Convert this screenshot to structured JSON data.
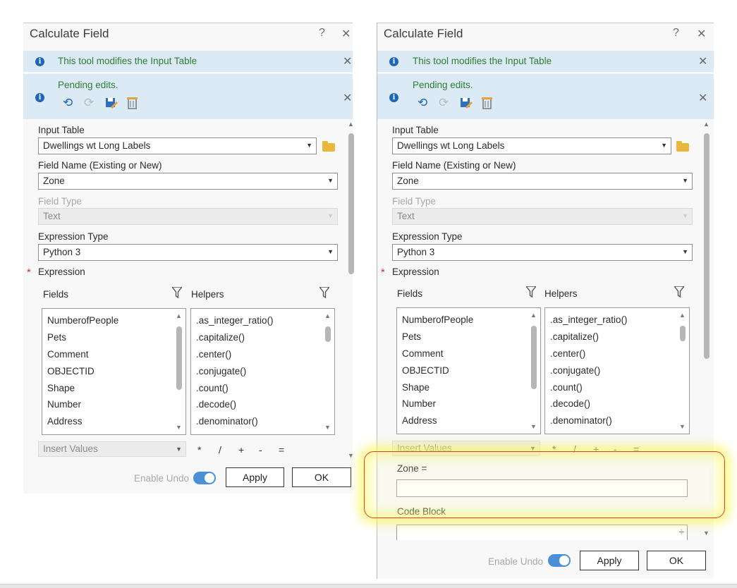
{
  "dialog": {
    "title": "Calculate Field",
    "help": "?",
    "close": "✕",
    "notice": "This tool modifies the Input Table",
    "pending": "Pending edits.",
    "input_table_label": "Input Table",
    "input_table_value": "Dwellings wt Long Labels",
    "field_name_label": "Field Name (Existing or New)",
    "field_name_value": "Zone",
    "field_type_label": "Field Type",
    "field_type_value": "Text",
    "expression_type_label": "Expression Type",
    "expression_type_value": "Python 3",
    "expression_label": "Expression",
    "required_mark": "*",
    "fields_label": "Fields",
    "helpers_label": "Helpers",
    "fields": [
      "NumberofPeople",
      "Pets",
      "Comment",
      "OBJECTID",
      "Shape",
      "Number",
      "Address"
    ],
    "helpers": [
      ".as_integer_ratio()",
      ".capitalize()",
      ".center()",
      ".conjugate()",
      ".count()",
      ".decode()",
      ".denominator()"
    ],
    "insert_values": "Insert Values",
    "ops": [
      "*",
      "/",
      "+",
      "-",
      "="
    ],
    "zone_expr_label": "Zone =",
    "code_block_label": "Code Block",
    "enable_undo": "Enable Undo",
    "apply": "Apply",
    "ok": "OK"
  },
  "icons": {
    "info": "info-icon",
    "undo": "undo-icon",
    "redo": "redo-icon",
    "save_edits": "save-edits-icon",
    "discard_edits": "discard-edits-icon",
    "folder": "folder-icon",
    "filter": "filter-icon"
  },
  "colors": {
    "banner": "#dbeaf4",
    "notice_text": "#2e7d32",
    "info_icon": "#1e66b8",
    "toggle_on": "#4a90d9",
    "highlight_border": "#e23a3a",
    "highlight_glow": "#faf564"
  }
}
